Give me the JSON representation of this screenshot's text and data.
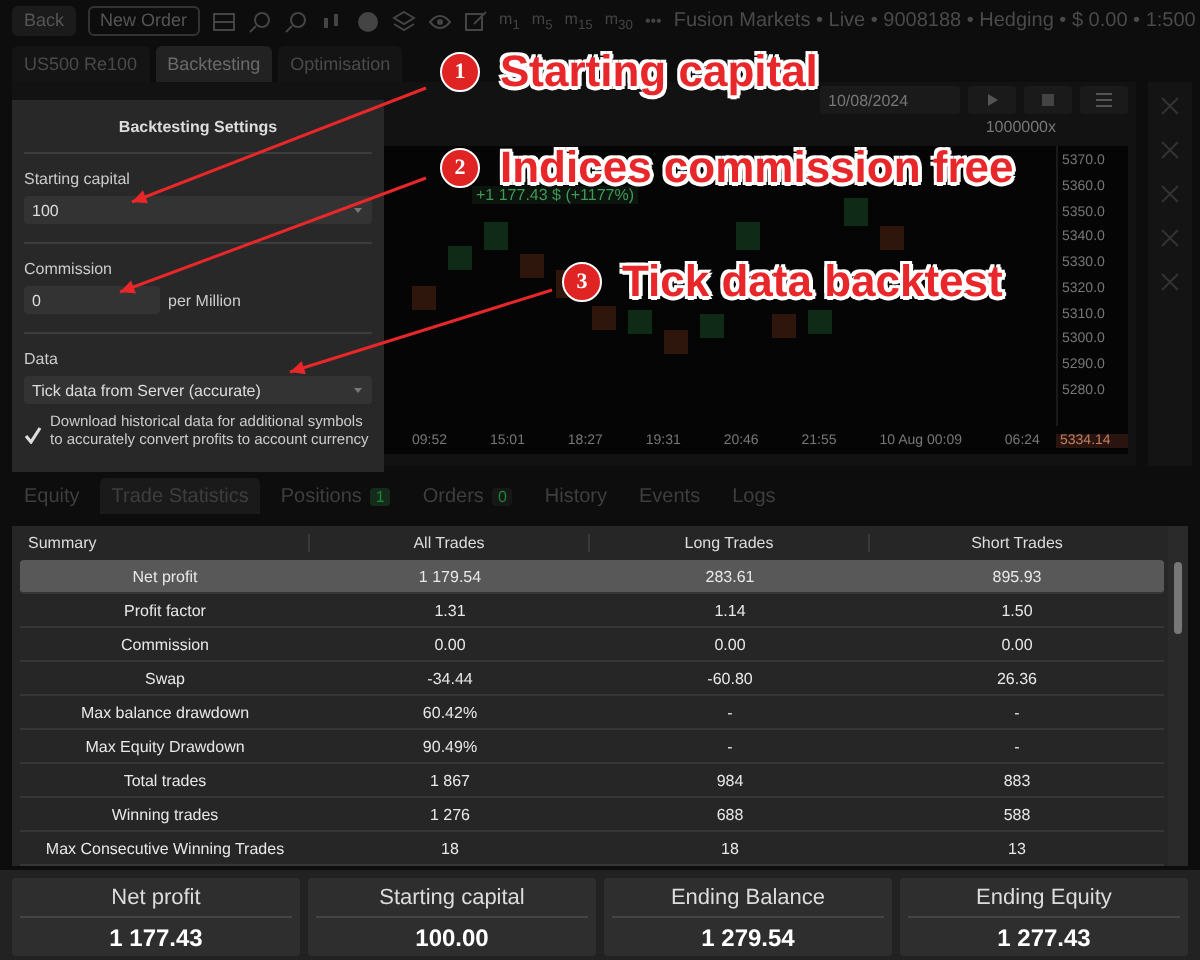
{
  "toolbar": {
    "buttons": [
      "Back",
      "New Order"
    ],
    "timeframes": [
      {
        "label": "m",
        "sub": "1"
      },
      {
        "label": "m",
        "sub": "5"
      },
      {
        "label": "m",
        "sub": "15"
      },
      {
        "label": "m",
        "sub": "30"
      }
    ],
    "more": "•••",
    "account": "Fusion Markets • Live • 9008188 • Hedging • $ 0.00 • 1:500"
  },
  "tabs": [
    {
      "label": "US500",
      "sub": "Re100",
      "selected": false
    },
    {
      "label": "Backtesting",
      "selected": true
    },
    {
      "label": "Optimisation",
      "selected": false
    }
  ],
  "chart": {
    "date": "10/08/2024",
    "speed": "1000000x",
    "profit": "+1 177.43 $ (+1177%)",
    "prices": [
      "5370.0",
      "5360.0",
      "5350.0",
      "5340.0",
      "5330.0",
      "5320.0",
      "5310.0",
      "5300.0",
      "5290.0",
      "5280.0"
    ],
    "current_price": "5334.14",
    "times": [
      "09:52",
      "15:01",
      "18:27",
      "19:31",
      "20:46",
      "21:55",
      "10 Aug 00:09",
      "06:24"
    ]
  },
  "settings": {
    "title": "Backtesting Settings",
    "capital_label": "Starting capital",
    "capital": "100",
    "commission_label": "Commission",
    "commission": "0",
    "commission_unit": "per Million",
    "data_label": "Data",
    "data": "Tick data from Server (accurate)",
    "download_checked": true,
    "download_text": "Download historical data for additional symbols to accurately convert profits to account currency"
  },
  "callouts": [
    {
      "number": "1",
      "text": "Starting capital"
    },
    {
      "number": "2",
      "text": "Indices commission free"
    },
    {
      "number": "3",
      "text": "Tick data backtest"
    }
  ],
  "bottom_tabs": [
    {
      "label": "Equity",
      "selected": false
    },
    {
      "label": "Trade Statistics",
      "selected": true
    },
    {
      "label": "Positions",
      "count": "1",
      "selected": false
    },
    {
      "label": "Orders",
      "count": "0",
      "selected": false
    },
    {
      "label": "History",
      "selected": false
    },
    {
      "label": "Events",
      "selected": false
    },
    {
      "label": "Logs",
      "selected": false
    }
  ],
  "table": {
    "columns": [
      "Summary",
      "All Trades",
      "Long Trades",
      "Short Trades"
    ],
    "rows": [
      {
        "cells": [
          "Net profit",
          "1 179.54",
          "283.61",
          "895.93"
        ],
        "selected": true
      },
      {
        "cells": [
          "Profit factor",
          "1.31",
          "1.14",
          "1.50"
        ],
        "selected": false
      },
      {
        "cells": [
          "Commission",
          "0.00",
          "0.00",
          "0.00"
        ],
        "selected": false
      },
      {
        "cells": [
          "Swap",
          "-34.44",
          "-60.80",
          "26.36"
        ],
        "selected": false
      },
      {
        "cells": [
          "Max balance drawdown",
          "60.42%",
          "-",
          "-"
        ],
        "selected": false
      },
      {
        "cells": [
          "Max Equity Drawdown",
          "90.49%",
          "-",
          "-"
        ],
        "selected": false
      },
      {
        "cells": [
          "Total trades",
          "1 867",
          "984",
          "883"
        ],
        "selected": false
      },
      {
        "cells": [
          "Winning trades",
          "1 276",
          "688",
          "588"
        ],
        "selected": false
      },
      {
        "cells": [
          "Max Consecutive Winning Trades",
          "18",
          "18",
          "13"
        ],
        "selected": false
      }
    ]
  },
  "cards": [
    {
      "label": "Net profit",
      "value": "1 177.43"
    },
    {
      "label": "Starting capital",
      "value": "100.00"
    },
    {
      "label": "Ending Balance",
      "value": "1 279.54"
    },
    {
      "label": "Ending Equity",
      "value": "1 277.43"
    }
  ]
}
